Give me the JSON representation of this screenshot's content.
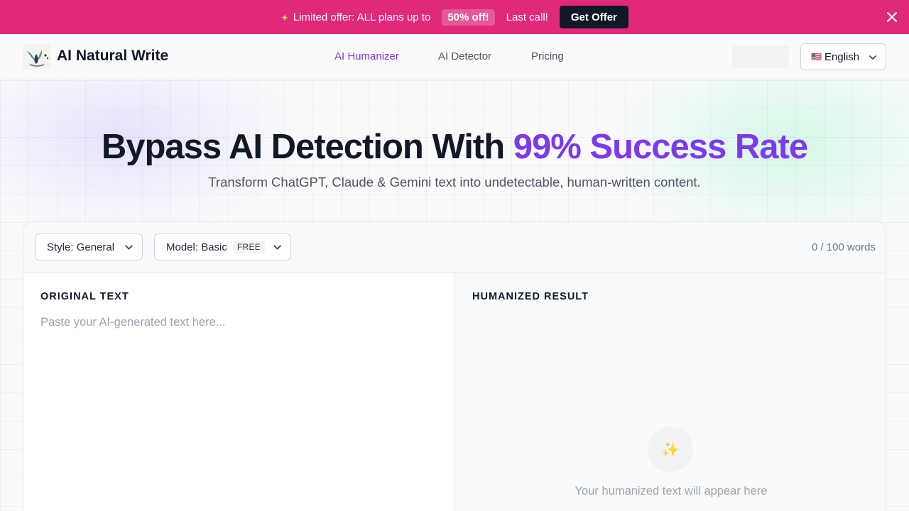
{
  "promo": {
    "spark_icon": "✦",
    "text": "Limited offer: ALL plans up to",
    "badge": "50% off!",
    "last_call": "Last call!",
    "button": "Get Offer",
    "bg_color": "#e1297a"
  },
  "header": {
    "brand": "AI Natural Write",
    "nav": [
      "AI Humanizer",
      "AI Detector",
      "Pricing"
    ],
    "active_nav": "AI Humanizer",
    "language": {
      "flag": "🇺🇸",
      "label": "English"
    }
  },
  "hero": {
    "headline_main": "Bypass AI Detection With ",
    "headline_accent": "99% Success Rate",
    "subhead": "Transform ChatGPT, Claude & Gemini text into undetectable, human-written content.",
    "accent_color": "#7c3aed"
  },
  "editor": {
    "style_dropdown": "Style: General",
    "model_dropdown": "Model: Basic",
    "model_badge": "FREE",
    "word_count": "0 / 100 words",
    "original_title": "ORIGINAL TEXT",
    "original_value": "",
    "original_placeholder": "Paste your AI-generated text here...",
    "result_title": "HUMANIZED RESULT",
    "result_icon": "✨",
    "result_hint": "Your humanized text will appear here"
  }
}
